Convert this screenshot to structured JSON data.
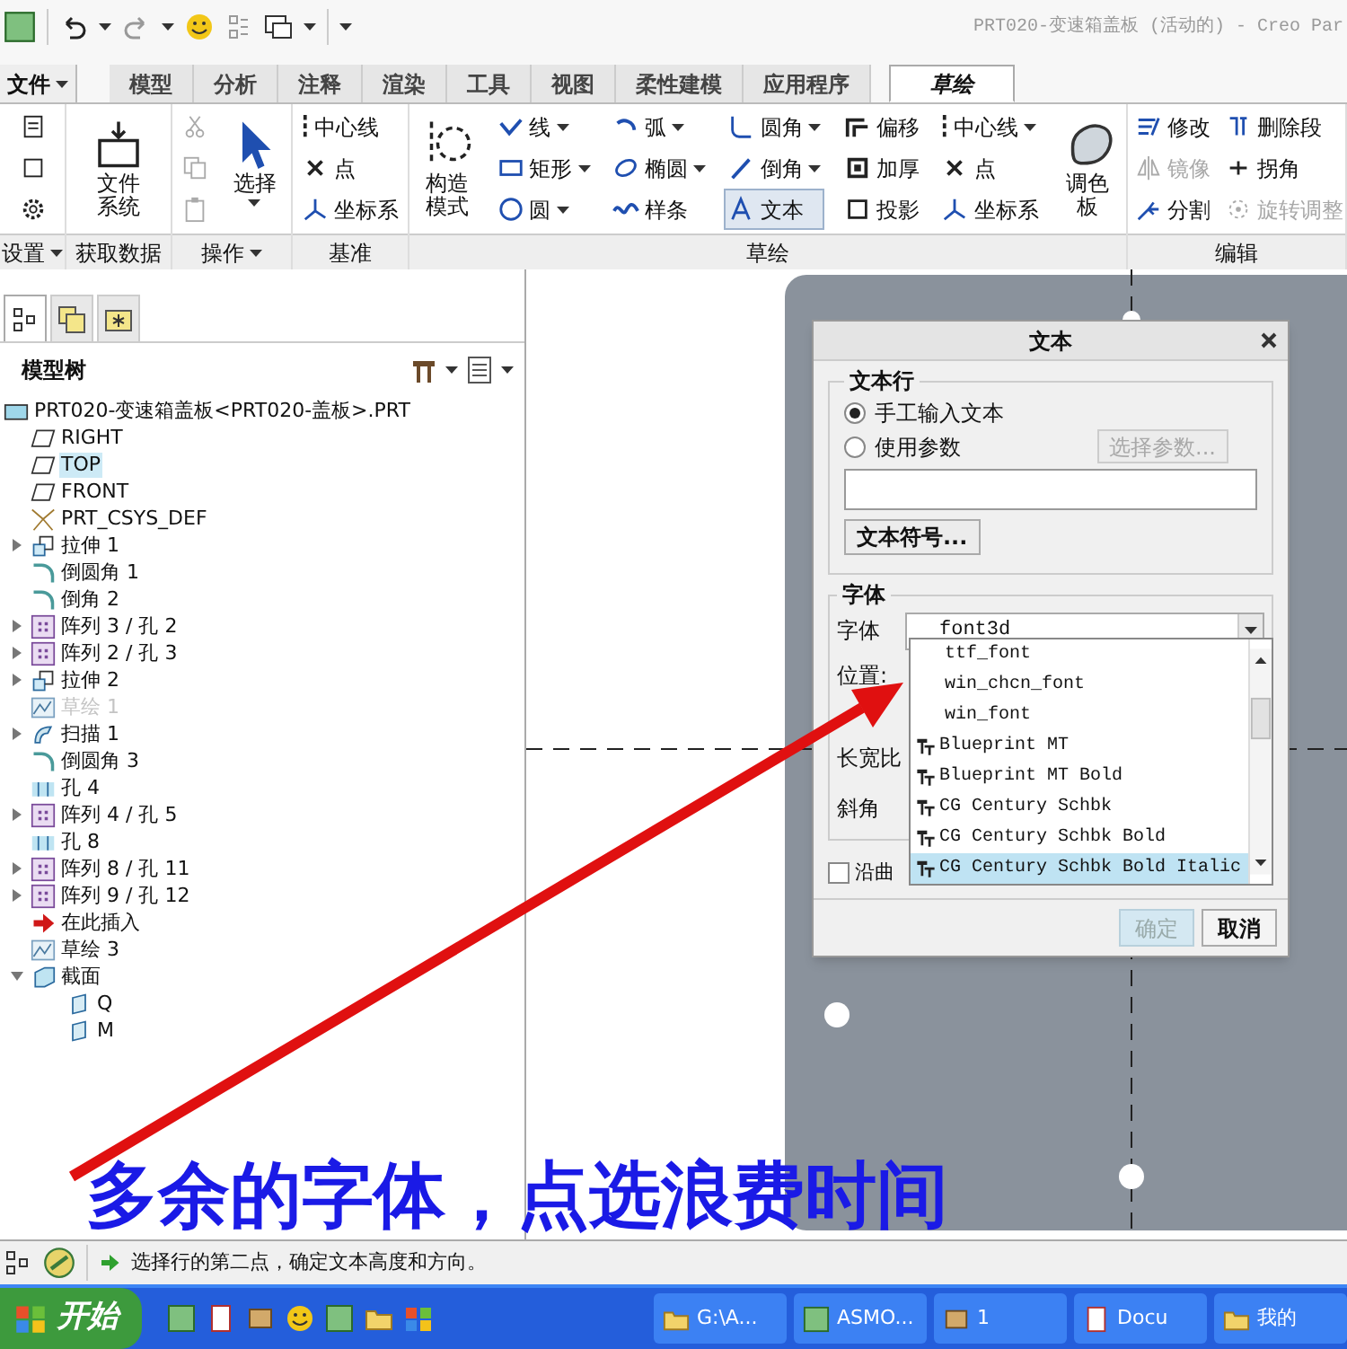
{
  "title_bar": {
    "title": "PRT020-变速箱盖板 (活动的) - Creo Par"
  },
  "ribbon_tabs": [
    {
      "label": "文件",
      "menu": true,
      "selected": false
    },
    {
      "label": "模型",
      "menu": false,
      "selected": false
    },
    {
      "label": "分析",
      "menu": false,
      "selected": false
    },
    {
      "label": "注释",
      "menu": false,
      "selected": false
    },
    {
      "label": "渲染",
      "menu": false,
      "selected": false
    },
    {
      "label": "工具",
      "menu": false,
      "selected": false
    },
    {
      "label": "视图",
      "menu": false,
      "selected": false
    },
    {
      "label": "柔性建模",
      "menu": false,
      "selected": false
    },
    {
      "label": "应用程序",
      "menu": false,
      "selected": false
    },
    {
      "label": "草绘",
      "menu": false,
      "selected": true
    }
  ],
  "ribbon_groups": [
    {
      "label": "设置",
      "menu": true,
      "columns": [
        [
          {
            "kind": "icon",
            "dropdown": false,
            "disabled": false,
            "selected": false
          },
          {
            "kind": "icon",
            "dropdown": false,
            "disabled": false,
            "selected": false
          },
          {
            "kind": "icon",
            "dropdown": false,
            "disabled": false,
            "selected": false
          }
        ]
      ]
    },
    {
      "label": "获取数据",
      "menu": false,
      "columns": [
        [
          {
            "kind": "large",
            "label": "文件系统",
            "dropdown": false,
            "disabled": false,
            "selected": false
          }
        ]
      ]
    },
    {
      "label": "操作",
      "menu": true,
      "columns": [
        [
          {
            "kind": "icon",
            "dropdown": false,
            "disabled": true,
            "selected": false
          },
          {
            "kind": "icon",
            "dropdown": false,
            "disabled": true,
            "selected": false
          },
          {
            "kind": "icon",
            "dropdown": false,
            "disabled": true,
            "selected": false
          }
        ],
        [
          {
            "kind": "large",
            "label": "选择",
            "dropdown": true,
            "disabled": false,
            "selected": false
          }
        ]
      ]
    },
    {
      "label": "基准",
      "menu": false,
      "columns": [
        [
          {
            "kind": "small",
            "label": "中心线",
            "dropdown": false,
            "disabled": false,
            "selected": false
          },
          {
            "kind": "small",
            "label": "点",
            "dropdown": false,
            "disabled": false,
            "selected": false
          },
          {
            "kind": "small",
            "label": "坐标系",
            "dropdown": false,
            "disabled": false,
            "selected": false
          }
        ]
      ]
    },
    {
      "label": "草绘",
      "menu": false,
      "columns": [
        [
          {
            "kind": "large",
            "label": "构造模式",
            "dropdown": false,
            "disabled": false,
            "selected": false
          }
        ],
        [
          {
            "kind": "small",
            "label": "线",
            "dropdown": true,
            "disabled": false,
            "selected": false
          },
          {
            "kind": "small",
            "label": "矩形",
            "dropdown": true,
            "disabled": false,
            "selected": false
          },
          {
            "kind": "small",
            "label": "圆",
            "dropdown": true,
            "disabled": false,
            "selected": false
          }
        ],
        [
          {
            "kind": "small",
            "label": "弧",
            "dropdown": true,
            "disabled": false,
            "selected": false
          },
          {
            "kind": "small",
            "label": "椭圆",
            "dropdown": true,
            "disabled": false,
            "selected": false
          },
          {
            "kind": "small",
            "label": "样条",
            "dropdown": false,
            "disabled": false,
            "selected": false
          }
        ],
        [
          {
            "kind": "small",
            "label": "圆角",
            "dropdown": true,
            "disabled": false,
            "selected": false
          },
          {
            "kind": "small",
            "label": "倒角",
            "dropdown": true,
            "disabled": false,
            "selected": false
          },
          {
            "kind": "small",
            "label": "文本",
            "dropdown": false,
            "disabled": false,
            "selected": true
          }
        ],
        [
          {
            "kind": "small",
            "label": "偏移",
            "dropdown": false,
            "disabled": false,
            "selected": false
          },
          {
            "kind": "small",
            "label": "加厚",
            "dropdown": false,
            "disabled": false,
            "selected": false
          },
          {
            "kind": "small",
            "label": "投影",
            "dropdown": false,
            "disabled": false,
            "selected": false
          }
        ],
        [
          {
            "kind": "small",
            "label": "中心线",
            "dropdown": true,
            "disabled": false,
            "selected": false
          },
          {
            "kind": "small",
            "label": "点",
            "dropdown": false,
            "disabled": false,
            "selected": false
          },
          {
            "kind": "small",
            "label": "坐标系",
            "dropdown": false,
            "disabled": false,
            "selected": false
          }
        ],
        [
          {
            "kind": "large",
            "label": "调色板",
            "dropdown": false,
            "disabled": false,
            "selected": false
          }
        ]
      ]
    },
    {
      "label": "编辑",
      "menu": false,
      "columns": [
        [
          {
            "kind": "small",
            "label": "修改",
            "dropdown": false,
            "disabled": false,
            "selected": false
          },
          {
            "kind": "small",
            "label": "镜像",
            "dropdown": false,
            "disabled": true,
            "selected": false
          },
          {
            "kind": "small",
            "label": "分割",
            "dropdown": false,
            "disabled": false,
            "selected": false
          }
        ],
        [
          {
            "kind": "small",
            "label": "删除段",
            "dropdown": false,
            "disabled": false,
            "selected": false
          },
          {
            "kind": "small",
            "label": "拐角",
            "dropdown": false,
            "disabled": false,
            "selected": false
          },
          {
            "kind": "small",
            "label": "旋转调整",
            "dropdown": false,
            "disabled": true,
            "selected": false
          }
        ]
      ]
    }
  ],
  "panel_tabs": [
    {
      "selected": true
    },
    {
      "selected": false
    },
    {
      "selected": false
    }
  ],
  "model_tree": {
    "title": "模型树",
    "items": [
      {
        "label": "PRT020-变速箱盖板<PRT020-盖板>.PRT",
        "kind": "part",
        "selected": false,
        "disabled": false,
        "children": [
          {
            "label": "RIGHT",
            "kind": "plane",
            "selected": false,
            "disabled": false
          },
          {
            "label": "TOP",
            "kind": "plane",
            "selected": true,
            "disabled": false
          },
          {
            "label": "FRONT",
            "kind": "plane",
            "selected": false,
            "disabled": false
          },
          {
            "label": "PRT_CSYS_DEF",
            "kind": "csys",
            "selected": false,
            "disabled": false
          },
          {
            "label": "拉伸 1",
            "kind": "extrude",
            "selected": false,
            "disabled": false,
            "expanded": false
          },
          {
            "label": "倒圆角 1",
            "kind": "round",
            "selected": false,
            "disabled": false
          },
          {
            "label": "倒角 2",
            "kind": "round",
            "selected": false,
            "disabled": false
          },
          {
            "label": "阵列 3 / 孔 2",
            "kind": "pattern",
            "selected": false,
            "disabled": false,
            "expanded": false
          },
          {
            "label": "阵列 2 / 孔 3",
            "kind": "pattern",
            "selected": false,
            "disabled": false,
            "expanded": false
          },
          {
            "label": "拉伸 2",
            "kind": "extrude",
            "selected": false,
            "disabled": false,
            "expanded": false
          },
          {
            "label": "草绘 1",
            "kind": "sketch",
            "selected": false,
            "disabled": true
          },
          {
            "label": "扫描 1",
            "kind": "sweep",
            "selected": false,
            "disabled": false,
            "expanded": false
          },
          {
            "label": "倒圆角 3",
            "kind": "round",
            "selected": false,
            "disabled": false
          },
          {
            "label": "孔 4",
            "kind": "hole",
            "selected": false,
            "disabled": false
          },
          {
            "label": "阵列 4 / 孔 5",
            "kind": "pattern",
            "selected": false,
            "disabled": false,
            "expanded": false
          },
          {
            "label": "孔 8",
            "kind": "hole",
            "selected": false,
            "disabled": false
          },
          {
            "label": "阵列 8 / 孔 11",
            "kind": "pattern",
            "selected": false,
            "disabled": false,
            "expanded": false
          },
          {
            "label": "阵列 9 / 孔 12",
            "kind": "pattern",
            "selected": false,
            "disabled": false,
            "expanded": false
          },
          {
            "label": "在此插入",
            "kind": "insert",
            "selected": false,
            "disabled": false
          },
          {
            "label": "草绘 3",
            "kind": "sketch",
            "selected": false,
            "disabled": false
          },
          {
            "label": "截面",
            "kind": "section",
            "selected": false,
            "disabled": false,
            "expanded": true,
            "children": [
              {
                "label": "Q",
                "kind": "section-item",
                "selected": false,
                "disabled": false
              },
              {
                "label": "M",
                "kind": "section-item",
                "selected": false,
                "disabled": false
              }
            ]
          }
        ]
      }
    ]
  },
  "text_dialog": {
    "title": "文本",
    "text_line": {
      "label": "文本行",
      "options": [
        {
          "label": "手工输入文本",
          "selected": true
        },
        {
          "label": "使用参数",
          "selected": false
        }
      ],
      "select_param": {
        "label": "选择参数...",
        "disabled": true
      },
      "symbol_button": "文本符号..."
    },
    "font": {
      "label": "字体",
      "font_label": "字体",
      "font_value": "font3d",
      "position_label": "位置:",
      "aspect_label": "长宽比",
      "slant_label": "斜角"
    },
    "along_curve": {
      "label": "沿曲",
      "checked": false
    },
    "font_list": [
      {
        "label": "ttf_font",
        "kind": "system",
        "selected": false
      },
      {
        "label": "win_chcn_font",
        "kind": "system",
        "selected": false
      },
      {
        "label": "win_font",
        "kind": "system",
        "selected": false
      },
      {
        "label": "Blueprint MT",
        "kind": "truetype",
        "selected": false
      },
      {
        "label": "Blueprint MT Bold",
        "kind": "truetype",
        "selected": false
      },
      {
        "label": "CG Century Schbk",
        "kind": "truetype",
        "selected": false
      },
      {
        "label": "CG Century Schbk Bold",
        "kind": "truetype",
        "selected": false
      },
      {
        "label": "CG Century Schbk Bold Italic",
        "kind": "truetype",
        "selected": true
      }
    ],
    "buttons": [
      {
        "label": "确定",
        "disabled": true
      },
      {
        "label": "取消",
        "disabled": false
      }
    ]
  },
  "annotation": {
    "text": "多余的字体，点选浪费时间"
  },
  "status_bar": {
    "message": "选择行的第二点，确定文本高度和方向。"
  },
  "taskbar": {
    "start": "开始",
    "tasks": [
      {
        "label": "G:\\A...",
        "kind": "folder"
      },
      {
        "label": "ASMO...",
        "kind": "app"
      },
      {
        "label": "1",
        "kind": "package"
      },
      {
        "label": "Docu",
        "kind": "document"
      },
      {
        "label": "我的",
        "kind": "folder"
      }
    ]
  }
}
